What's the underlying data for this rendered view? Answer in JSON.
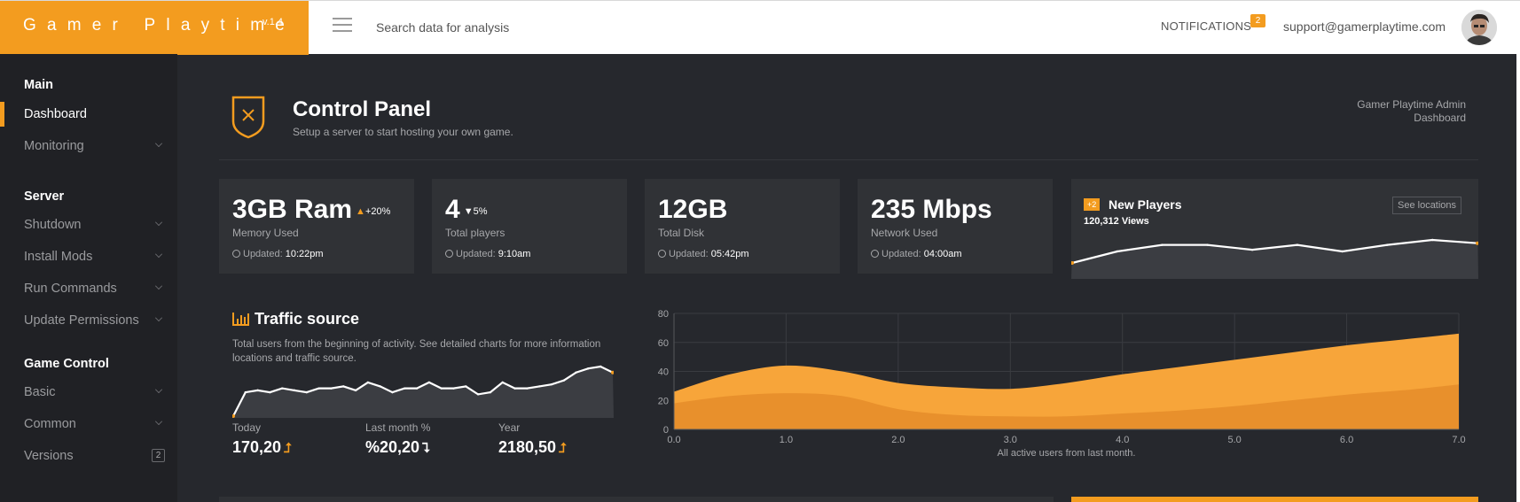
{
  "brand": {
    "name": "Gamer Playtime",
    "version": "v.1.4",
    "color": "#f39c1f"
  },
  "topbar": {
    "menu_icon": "hamburger-icon",
    "search_placeholder": "Search data for analysis",
    "notifications_label": "NOTIFICATIONS",
    "notifications_count": "2",
    "email": "support@gamerplaytime.com"
  },
  "sidebar": {
    "sections": [
      {
        "title": "Main",
        "items": [
          {
            "label": "Dashboard",
            "active": true
          },
          {
            "label": "Monitoring",
            "chevron": true
          }
        ]
      },
      {
        "title": "Server",
        "items": [
          {
            "label": "Shutdown",
            "chevron": true
          },
          {
            "label": "Install Mods",
            "chevron": true
          },
          {
            "label": "Run Commands",
            "chevron": true
          },
          {
            "label": "Update Permissions",
            "chevron": true
          }
        ]
      },
      {
        "title": "Game Control",
        "items": [
          {
            "label": "Basic",
            "chevron": true
          },
          {
            "label": "Common",
            "chevron": true
          },
          {
            "label": "Versions",
            "count": "2"
          }
        ]
      }
    ]
  },
  "header": {
    "icon": "shield-x-icon",
    "title": "Control Panel",
    "subtitle": "Setup a server to start hosting your own game.",
    "breadcrumb": [
      "Gamer Playtime Admin",
      "Dashboard"
    ]
  },
  "stats": [
    {
      "value": "3GB Ram",
      "delta": "+20%",
      "trend": "up",
      "label": "Memory Used",
      "updated_prefix": "Updated:",
      "updated": "10:22pm"
    },
    {
      "value": "4",
      "delta": "5%",
      "trend": "down",
      "label": "Total players",
      "updated_prefix": "Updated:",
      "updated": "9:10am"
    },
    {
      "value": "12GB",
      "label": "Total Disk",
      "updated_prefix": "Updated:",
      "updated": "05:42pm"
    },
    {
      "value": "235 Mbps",
      "label": "Network Used",
      "updated_prefix": "Updated:",
      "updated": "04:00am"
    }
  ],
  "new_players": {
    "badge": "+2",
    "title": "New Players",
    "views": "120,312 Views",
    "button": "See locations",
    "spark": [
      0,
      7,
      11,
      11,
      8,
      11,
      7,
      11,
      14,
      12
    ]
  },
  "traffic": {
    "icon": "bar-chart-icon",
    "title": "Traffic source",
    "description": "Total users from the beginning of activity. See detailed charts for more information locations and traffic source.",
    "spark": [
      0,
      12,
      13,
      12,
      14,
      13,
      12,
      14,
      14,
      15,
      13,
      17,
      15,
      12,
      14,
      14,
      17,
      14,
      14,
      15,
      11,
      12,
      17,
      14,
      14,
      15,
      16,
      18,
      22,
      24,
      25,
      22
    ],
    "kpis": [
      {
        "label": "Today",
        "value": "170,20",
        "trend": "up"
      },
      {
        "label": "Last month %",
        "value": "%20,20",
        "trend": "down"
      },
      {
        "label": "Year",
        "value": "2180,50",
        "trend": "up"
      }
    ]
  },
  "chart_data": {
    "type": "area",
    "x": [
      0.0,
      0.5,
      1.0,
      1.5,
      2.0,
      2.5,
      3.0,
      3.5,
      4.0,
      4.5,
      5.0,
      5.5,
      6.0,
      6.5,
      7.0
    ],
    "series": [
      {
        "values": [
          26,
          38,
          44,
          40,
          32,
          29,
          28,
          32,
          38,
          43,
          48,
          53,
          58,
          62,
          66
        ],
        "color": "#f7a53a"
      },
      {
        "values": [
          18,
          23,
          25,
          23,
          14,
          10,
          9,
          9,
          11,
          13,
          16,
          20,
          24,
          27,
          31
        ],
        "color": "#e8902c"
      }
    ],
    "xticks": [
      "0.0",
      "1.0",
      "2.0",
      "3.0",
      "4.0",
      "5.0",
      "6.0",
      "7.0"
    ],
    "yticks": [
      "0",
      "20",
      "40",
      "60",
      "80"
    ],
    "xlim": [
      0,
      7
    ],
    "ylim": [
      0,
      80
    ],
    "caption": "All active users from last month.",
    "grid": true
  }
}
